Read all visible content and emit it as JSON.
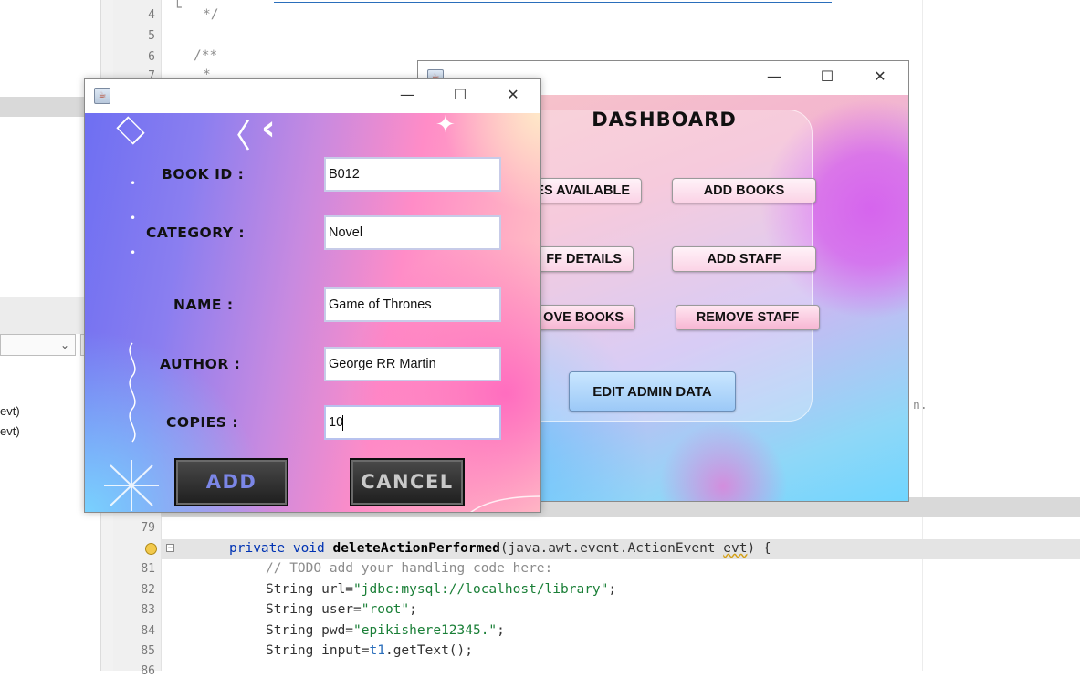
{
  "ide": {
    "line_numbers": {
      "l4": "4",
      "l5": "5",
      "l6": "6",
      "l7": "7",
      "l79": "79",
      "l80": "",
      "l81": "81",
      "l82": "82",
      "l83": "83",
      "l84": "84",
      "l85": "85",
      "l86": "86"
    },
    "comment_end": "*/",
    "javadoc_start": "/**",
    "javadoc_star": "*",
    "left_panel": {
      "evt1": "evt)",
      "evt2": "evt)"
    },
    "right_trunc": "n.",
    "code": {
      "method_decl": {
        "kw": "private void ",
        "name": "deleteActionPerformed",
        "params": "(java.awt.event.ActionEvent ",
        "evt": "evt",
        "end": ") {"
      },
      "todo": "// TODO add your handling code here:",
      "url": {
        "pre": "String url=",
        "val": "\"jdbc:mysql://localhost/library\"",
        "end": ";"
      },
      "user": {
        "pre": "String user=",
        "val": "\"root\"",
        "end": ";"
      },
      "pwd": {
        "pre": "String pwd=",
        "val": "\"epikishere12345.\"",
        "end": ";"
      },
      "input": {
        "pre": "String input=",
        "var": "t1",
        "end": ".getText();"
      }
    }
  },
  "dashboard": {
    "title": "DASHBOARD",
    "buttons": {
      "books_available": "ES AVAILABLE",
      "add_books": "ADD BOOKS",
      "staff_details": "FF DETAILS",
      "add_staff": "ADD STAFF",
      "remove_books": "OVE BOOKS",
      "remove_staff": "REMOVE STAFF",
      "edit_admin": "EDIT ADMIN DATA"
    }
  },
  "add_book_dialog": {
    "fields": {
      "book_id": {
        "label": "BOOK ID :",
        "value": "B012"
      },
      "category": {
        "label": "CATEGORY :",
        "value": "Novel"
      },
      "name": {
        "label": "NAME :",
        "value": "Game of Thrones"
      },
      "author": {
        "label": "AUTHOR :",
        "value": "George RR Martin"
      },
      "copies": {
        "label": "COPIES :",
        "value": "10"
      }
    },
    "add_label": "ADD",
    "cancel_label": "CANCEL"
  },
  "colors": {
    "add_text": "#7b86e6",
    "cancel_text": "#c9c9c9",
    "dash_button": "#fbd3e6",
    "edit_button": "#9cc9f7"
  },
  "icons": {
    "window_icon": "java-cup-icon",
    "minimize": "minimize-icon",
    "maximize": "maximize-icon",
    "close": "close-icon"
  }
}
